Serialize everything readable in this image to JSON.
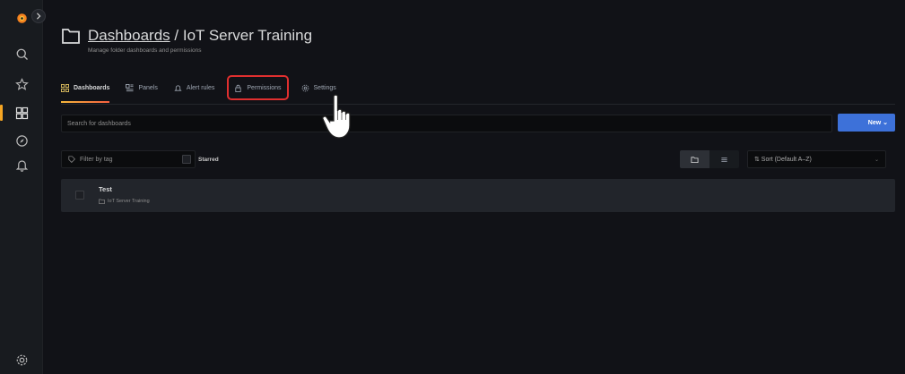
{
  "header": {
    "breadcrumb_parent": "Dashboards",
    "breadcrumb_separator": " / ",
    "breadcrumb_current": "IoT Server Training",
    "subtitle": "Manage folder dashboards and permissions"
  },
  "tabs": [
    {
      "label": "Dashboards",
      "icon": "apps-icon",
      "active": true
    },
    {
      "label": "Panels",
      "icon": "library-panel-icon",
      "active": false
    },
    {
      "label": "Alert rules",
      "icon": "bell-icon",
      "active": false
    },
    {
      "label": "Permissions",
      "icon": "lock-icon",
      "active": false,
      "highlighted": true
    },
    {
      "label": "Settings",
      "icon": "cog-icon",
      "active": false
    }
  ],
  "search": {
    "placeholder": "Search for dashboards"
  },
  "new_button": {
    "label": "New ⌄"
  },
  "filter": {
    "placeholder": "Filter by tag",
    "chevron": "⌄"
  },
  "starred": {
    "label": "Starred"
  },
  "sort": {
    "label": "⇅ Sort (Default A–Z)",
    "chevron": "⌄"
  },
  "dashboards": [
    {
      "title": "Test",
      "folder": "IoT Server Training"
    }
  ],
  "colors": {
    "background": "#111217",
    "accent_gradient": [
      "#f5b73b",
      "#f55f3e"
    ],
    "primary_button": "#3d71d9",
    "highlight_box": "#e02f2f"
  }
}
